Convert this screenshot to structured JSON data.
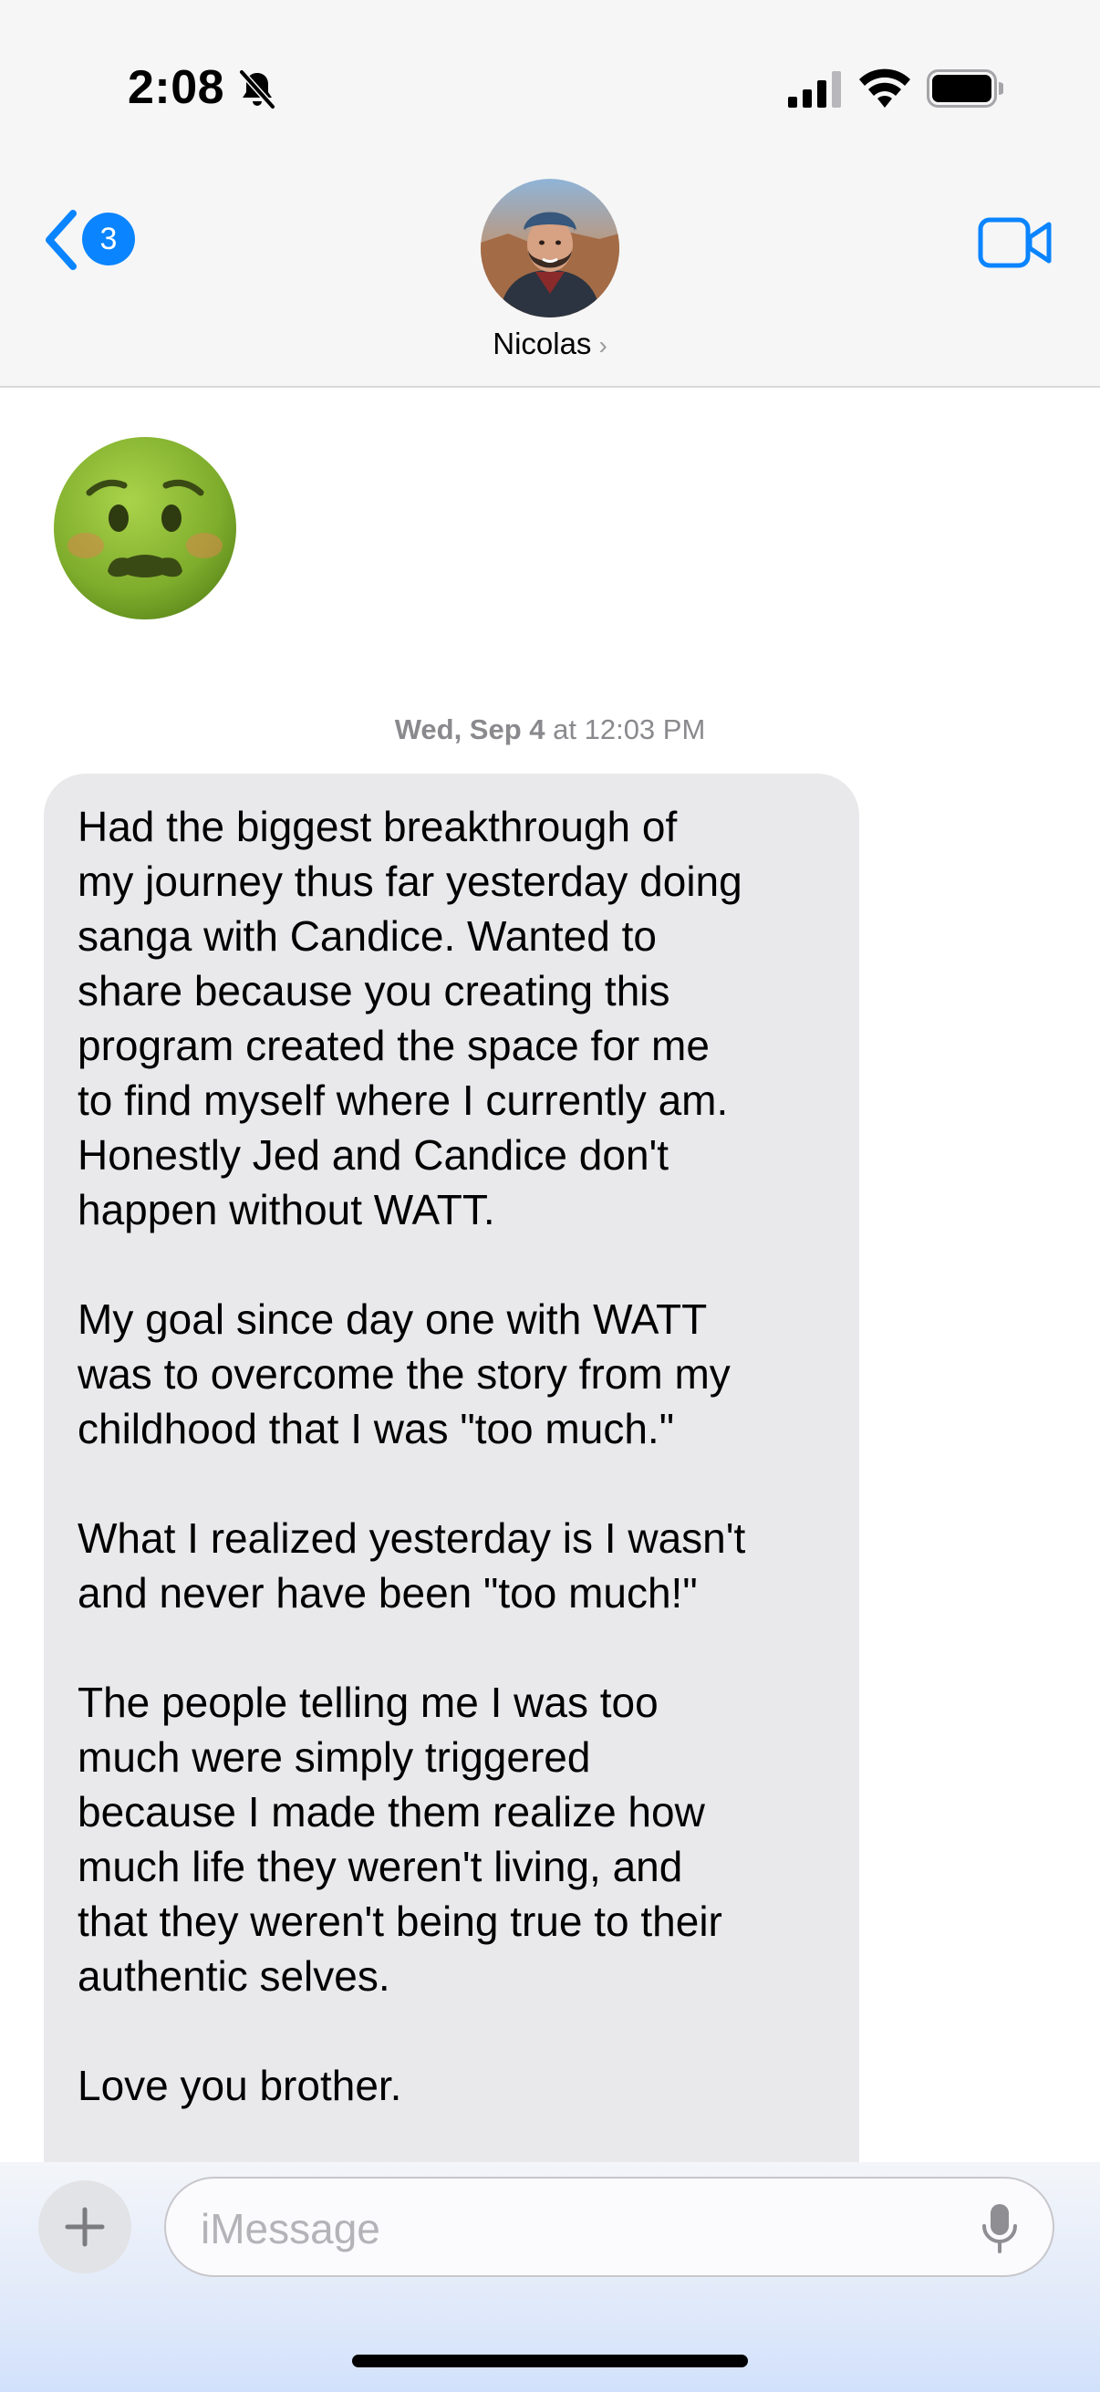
{
  "status_bar": {
    "time": "2:08",
    "icons": [
      "bell-slash-icon",
      "cellular-signal-icon",
      "wifi-icon",
      "battery-icon"
    ]
  },
  "header": {
    "back_badge": "3",
    "contact_name": "Nicolas",
    "contact_chevron": "›",
    "icons": [
      "back-chevron-icon",
      "video-call-icon"
    ]
  },
  "messages": {
    "emoji": "🤢 nauseated face emoji",
    "timestamp": {
      "day": "Wed, Sep 4",
      "time": " at 12:03 PM"
    },
    "bubble_text": "Had the biggest breakthrough of\nmy journey thus far yesterday doing\nsanga with Candice. Wanted to\nshare because you creating this\nprogram created the space for me\nto find myself where I currently am.\nHonestly Jed and Candice don't\nhappen without WATT.\n\nMy goal since day one with WATT\nwas to overcome the story from my\nchildhood that I was \"too much.\"\n\nWhat I realized yesterday is I wasn't\nand never have been \"too much!\"\n\nThe people telling me I was too\nmuch were simply triggered\nbecause I made them realize how\nmuch life they weren't living, and\nthat they weren't being true to their\nauthentic selves.\n\nLove you brother."
  },
  "composer": {
    "placeholder": "iMessage",
    "icons": [
      "plus-icon",
      "microphone-icon"
    ]
  },
  "colors": {
    "accent": "#0a84ff",
    "bubble_incoming": "#e9e9eb",
    "header_bg": "#f6f6f6"
  }
}
